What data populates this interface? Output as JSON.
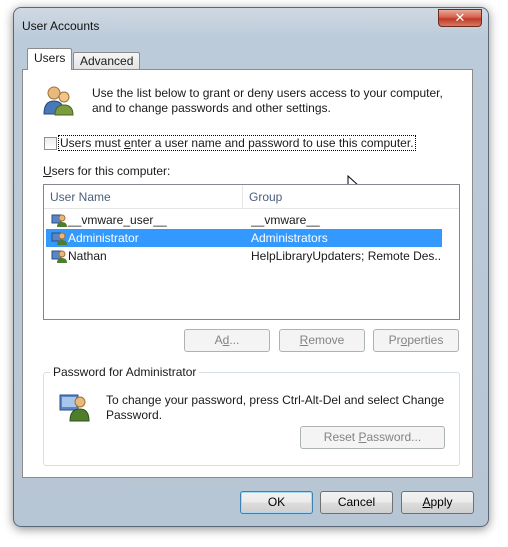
{
  "window": {
    "title": "User Accounts",
    "close_glyph": "✕"
  },
  "tabs": [
    {
      "label": "Users",
      "active": true
    },
    {
      "label": "Advanced",
      "active": false
    }
  ],
  "intro": {
    "text_line1": "Use the list below to grant or deny users access to your computer,",
    "text_line2": "and to change passwords and other settings.",
    "icon": "users-group-icon"
  },
  "checkbox": {
    "label_pre": "Users must ",
    "label_accel": "e",
    "label_post": "nter a user name and password to use this computer.",
    "checked": false
  },
  "users_list": {
    "label_accel": "U",
    "label_rest": "sers for this computer:",
    "columns": [
      "User Name",
      "Group"
    ],
    "rows": [
      {
        "name": "__vmware_user__",
        "group": "__vmware__",
        "selected": false
      },
      {
        "name": "Administrator",
        "group": "Administrators",
        "selected": true
      },
      {
        "name": "Nathan",
        "group": "HelpLibraryUpdaters; Remote Des...",
        "selected": false
      }
    ]
  },
  "list_buttons": {
    "add_accel": "d",
    "add_pre": "A",
    "add_post": "d...",
    "remove_accel": "R",
    "remove_rest": "emove",
    "properties_pre": "Pr",
    "properties_accel": "o",
    "properties_post": "perties"
  },
  "password_group": {
    "title": "Password for Administrator",
    "text_line1": "To change your password, press Ctrl-Alt-Del and select Change",
    "text_line2": "Password.",
    "reset_pre": "Reset ",
    "reset_accel": "P",
    "reset_post": "assword..."
  },
  "footer": {
    "ok": "OK",
    "cancel": "Cancel",
    "apply_accel": "A",
    "apply_rest": "pply"
  },
  "colors": {
    "selection": "#3399ff",
    "header_text": "#4c607a"
  }
}
